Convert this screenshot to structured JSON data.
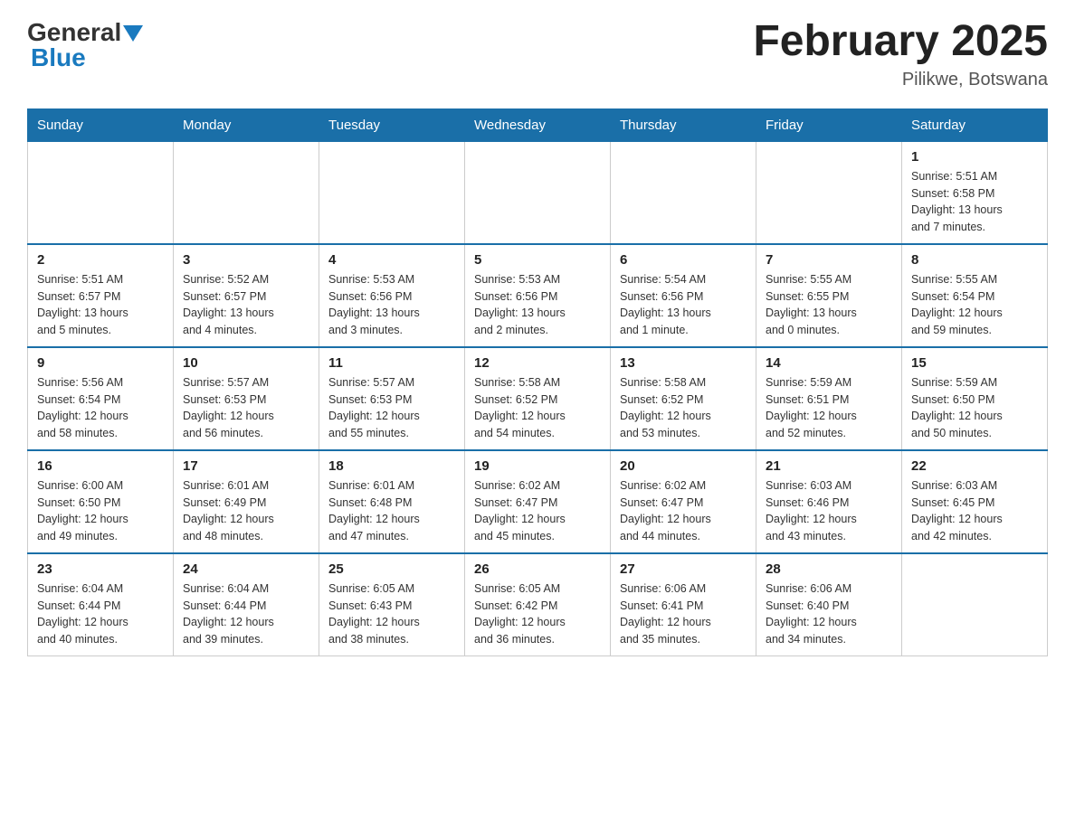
{
  "header": {
    "logo_general": "General",
    "logo_blue": "Blue",
    "month_year": "February 2025",
    "location": "Pilikwe, Botswana"
  },
  "weekdays": [
    "Sunday",
    "Monday",
    "Tuesday",
    "Wednesday",
    "Thursday",
    "Friday",
    "Saturday"
  ],
  "weeks": [
    {
      "days": [
        {
          "date": "",
          "info": ""
        },
        {
          "date": "",
          "info": ""
        },
        {
          "date": "",
          "info": ""
        },
        {
          "date": "",
          "info": ""
        },
        {
          "date": "",
          "info": ""
        },
        {
          "date": "",
          "info": ""
        },
        {
          "date": "1",
          "info": "Sunrise: 5:51 AM\nSunset: 6:58 PM\nDaylight: 13 hours\nand 7 minutes."
        }
      ]
    },
    {
      "days": [
        {
          "date": "2",
          "info": "Sunrise: 5:51 AM\nSunset: 6:57 PM\nDaylight: 13 hours\nand 5 minutes."
        },
        {
          "date": "3",
          "info": "Sunrise: 5:52 AM\nSunset: 6:57 PM\nDaylight: 13 hours\nand 4 minutes."
        },
        {
          "date": "4",
          "info": "Sunrise: 5:53 AM\nSunset: 6:56 PM\nDaylight: 13 hours\nand 3 minutes."
        },
        {
          "date": "5",
          "info": "Sunrise: 5:53 AM\nSunset: 6:56 PM\nDaylight: 13 hours\nand 2 minutes."
        },
        {
          "date": "6",
          "info": "Sunrise: 5:54 AM\nSunset: 6:56 PM\nDaylight: 13 hours\nand 1 minute."
        },
        {
          "date": "7",
          "info": "Sunrise: 5:55 AM\nSunset: 6:55 PM\nDaylight: 13 hours\nand 0 minutes."
        },
        {
          "date": "8",
          "info": "Sunrise: 5:55 AM\nSunset: 6:54 PM\nDaylight: 12 hours\nand 59 minutes."
        }
      ]
    },
    {
      "days": [
        {
          "date": "9",
          "info": "Sunrise: 5:56 AM\nSunset: 6:54 PM\nDaylight: 12 hours\nand 58 minutes."
        },
        {
          "date": "10",
          "info": "Sunrise: 5:57 AM\nSunset: 6:53 PM\nDaylight: 12 hours\nand 56 minutes."
        },
        {
          "date": "11",
          "info": "Sunrise: 5:57 AM\nSunset: 6:53 PM\nDaylight: 12 hours\nand 55 minutes."
        },
        {
          "date": "12",
          "info": "Sunrise: 5:58 AM\nSunset: 6:52 PM\nDaylight: 12 hours\nand 54 minutes."
        },
        {
          "date": "13",
          "info": "Sunrise: 5:58 AM\nSunset: 6:52 PM\nDaylight: 12 hours\nand 53 minutes."
        },
        {
          "date": "14",
          "info": "Sunrise: 5:59 AM\nSunset: 6:51 PM\nDaylight: 12 hours\nand 52 minutes."
        },
        {
          "date": "15",
          "info": "Sunrise: 5:59 AM\nSunset: 6:50 PM\nDaylight: 12 hours\nand 50 minutes."
        }
      ]
    },
    {
      "days": [
        {
          "date": "16",
          "info": "Sunrise: 6:00 AM\nSunset: 6:50 PM\nDaylight: 12 hours\nand 49 minutes."
        },
        {
          "date": "17",
          "info": "Sunrise: 6:01 AM\nSunset: 6:49 PM\nDaylight: 12 hours\nand 48 minutes."
        },
        {
          "date": "18",
          "info": "Sunrise: 6:01 AM\nSunset: 6:48 PM\nDaylight: 12 hours\nand 47 minutes."
        },
        {
          "date": "19",
          "info": "Sunrise: 6:02 AM\nSunset: 6:47 PM\nDaylight: 12 hours\nand 45 minutes."
        },
        {
          "date": "20",
          "info": "Sunrise: 6:02 AM\nSunset: 6:47 PM\nDaylight: 12 hours\nand 44 minutes."
        },
        {
          "date": "21",
          "info": "Sunrise: 6:03 AM\nSunset: 6:46 PM\nDaylight: 12 hours\nand 43 minutes."
        },
        {
          "date": "22",
          "info": "Sunrise: 6:03 AM\nSunset: 6:45 PM\nDaylight: 12 hours\nand 42 minutes."
        }
      ]
    },
    {
      "days": [
        {
          "date": "23",
          "info": "Sunrise: 6:04 AM\nSunset: 6:44 PM\nDaylight: 12 hours\nand 40 minutes."
        },
        {
          "date": "24",
          "info": "Sunrise: 6:04 AM\nSunset: 6:44 PM\nDaylight: 12 hours\nand 39 minutes."
        },
        {
          "date": "25",
          "info": "Sunrise: 6:05 AM\nSunset: 6:43 PM\nDaylight: 12 hours\nand 38 minutes."
        },
        {
          "date": "26",
          "info": "Sunrise: 6:05 AM\nSunset: 6:42 PM\nDaylight: 12 hours\nand 36 minutes."
        },
        {
          "date": "27",
          "info": "Sunrise: 6:06 AM\nSunset: 6:41 PM\nDaylight: 12 hours\nand 35 minutes."
        },
        {
          "date": "28",
          "info": "Sunrise: 6:06 AM\nSunset: 6:40 PM\nDaylight: 12 hours\nand 34 minutes."
        },
        {
          "date": "",
          "info": ""
        }
      ]
    }
  ]
}
